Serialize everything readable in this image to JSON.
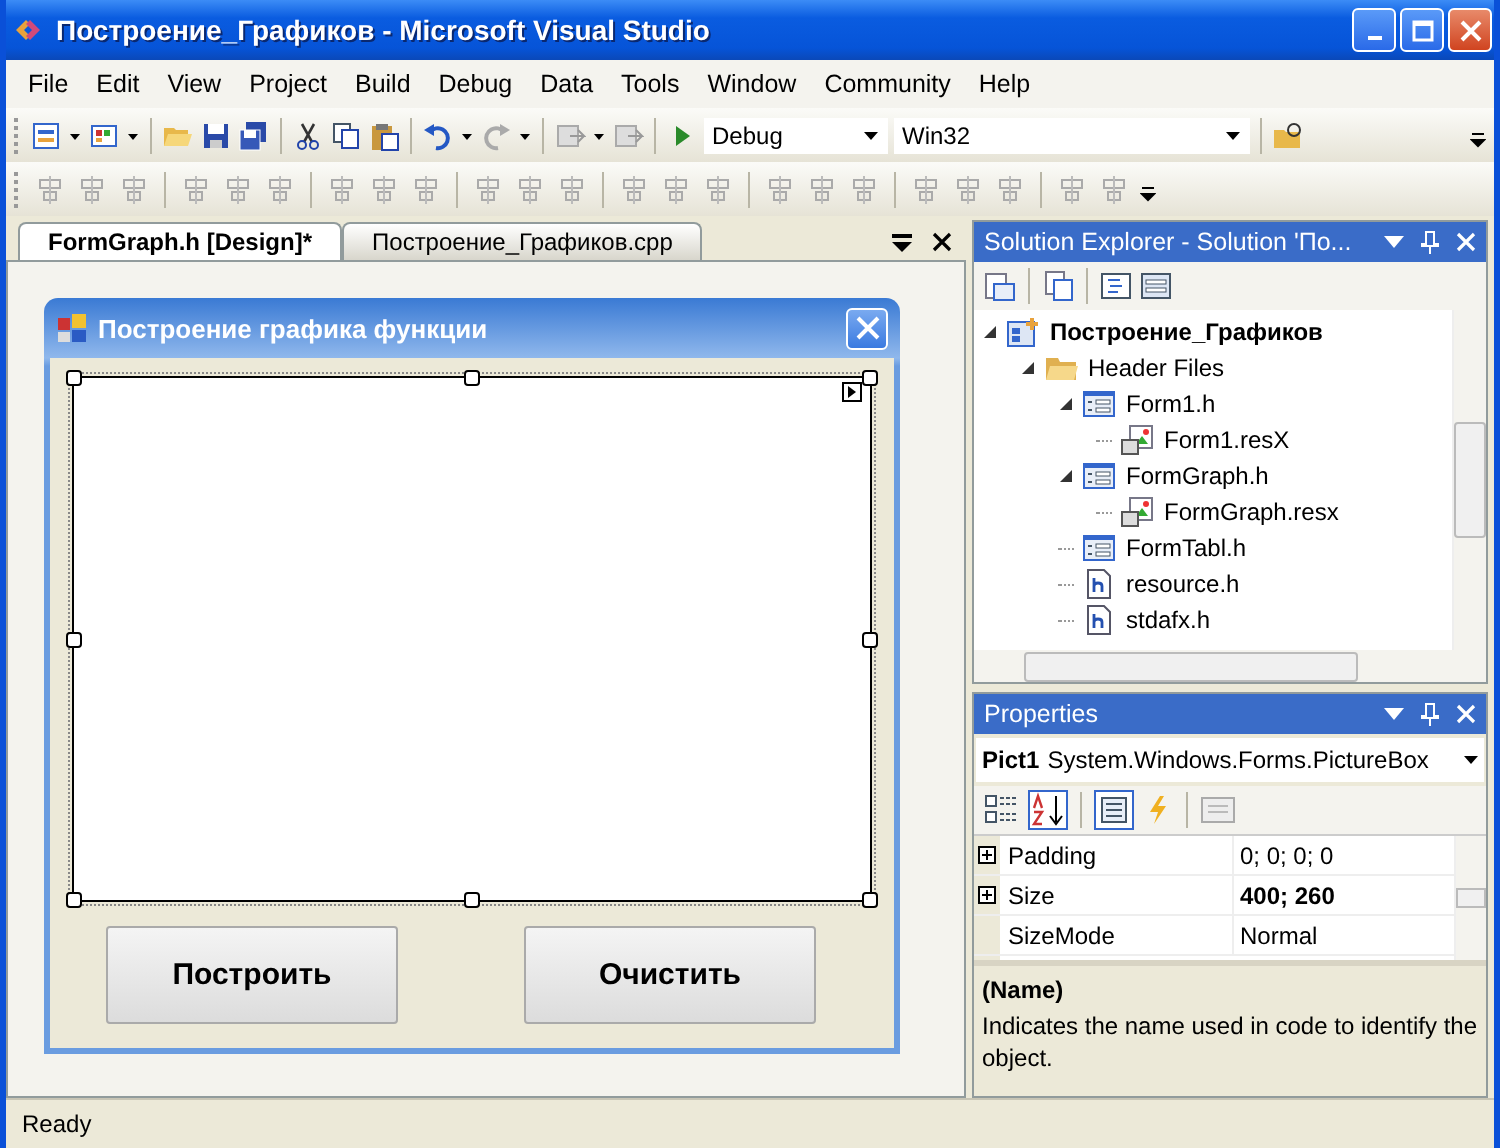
{
  "window": {
    "title": "Построение_Графиков - Microsoft Visual Studio"
  },
  "menu": [
    "File",
    "Edit",
    "View",
    "Project",
    "Build",
    "Debug",
    "Data",
    "Tools",
    "Window",
    "Community",
    "Help"
  ],
  "toolbar": {
    "configuration": "Debug",
    "platform": "Win32"
  },
  "tabs": [
    {
      "label": "FormGraph.h [Design]*",
      "selected": true
    },
    {
      "label": "Построение_Графиков.cpp",
      "selected": false
    }
  ],
  "designer": {
    "form_title": "Построение графика функции",
    "buttons": [
      "Построить",
      "Очистить"
    ]
  },
  "solution_explorer": {
    "title": "Solution Explorer - Solution 'По...",
    "tree": [
      {
        "label": "Построение_Графиков",
        "kind": "project",
        "expanded": true,
        "children": [
          {
            "label": "Header Files",
            "kind": "folder",
            "expanded": true,
            "children": [
              {
                "label": "Form1.h",
                "kind": "form",
                "expanded": true,
                "children": [
                  {
                    "label": "Form1.resX",
                    "kind": "resource"
                  }
                ]
              },
              {
                "label": "FormGraph.h",
                "kind": "form",
                "expanded": true,
                "children": [
                  {
                    "label": "FormGraph.resx",
                    "kind": "resource"
                  }
                ]
              },
              {
                "label": "FormTabl.h",
                "kind": "form"
              },
              {
                "label": "resource.h",
                "kind": "header"
              },
              {
                "label": "stdafx.h",
                "kind": "header"
              }
            ]
          }
        ]
      }
    ]
  },
  "properties": {
    "title": "Properties",
    "object_name": "Pict1",
    "object_type": "System.Windows.Forms.PictureBox",
    "rows": [
      {
        "name": "Padding",
        "value": "0; 0; 0; 0",
        "expandable": true,
        "modified": false
      },
      {
        "name": "Size",
        "value": "400; 260",
        "expandable": true,
        "modified": true
      },
      {
        "name": "SizeMode",
        "value": "Normal",
        "expandable": false,
        "modified": false
      }
    ],
    "description_title": "(Name)",
    "description": "Indicates the name used in code to identify the object."
  },
  "status_bar": "Ready"
}
